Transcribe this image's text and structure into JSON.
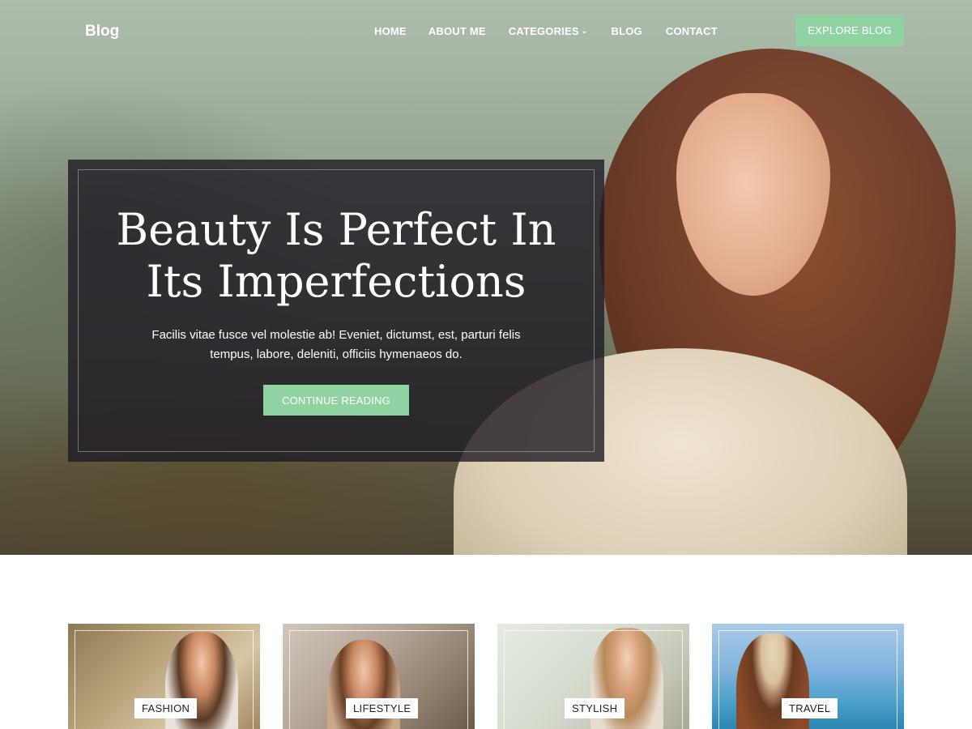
{
  "header": {
    "logo": "Blog",
    "nav": [
      {
        "label": "HOME"
      },
      {
        "label": "ABOUT ME"
      },
      {
        "label": "CATEGORIES",
        "has_dropdown": true
      },
      {
        "label": "BLOG"
      },
      {
        "label": "CONTACT"
      }
    ],
    "cta_label": "EXPLORE BLOG"
  },
  "hero": {
    "title": "Beauty Is Perfect In Its Imperfections",
    "text": "Facilis vitae fusce vel molestie ab! Eveniet, dictumst, est, parturi felis tempus, labore, deleniti, officiis hymenaeos do.",
    "button_label": "CONTINUE READING"
  },
  "categories": [
    {
      "label": "FASHION"
    },
    {
      "label": "LIFESTYLE"
    },
    {
      "label": "STYLISH"
    },
    {
      "label": "TRAVEL"
    }
  ],
  "colors": {
    "accent": "#8fd3a3",
    "card_overlay": "#1e1a24",
    "text_light": "#ffffff",
    "text_dark": "#222222"
  },
  "icons": {
    "dropdown": "chevron-down-icon"
  }
}
